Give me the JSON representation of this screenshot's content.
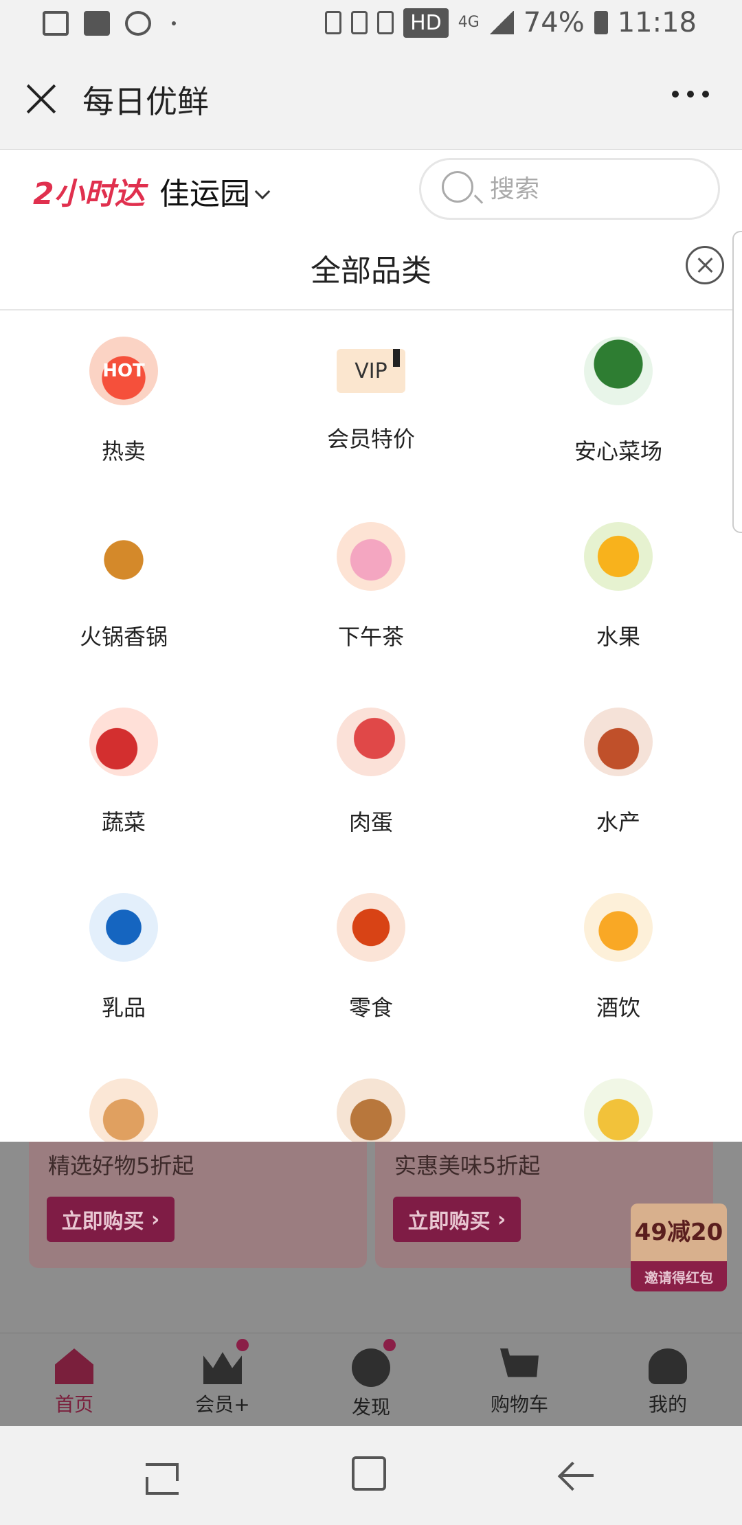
{
  "status_bar": {
    "network": "4G",
    "hd": "HD",
    "battery": "74%",
    "time": "11:18"
  },
  "title_bar": {
    "title": "每日优鲜"
  },
  "location_bar": {
    "brand": "2小时达",
    "location": "佳运园",
    "search_placeholder": "搜索"
  },
  "category_panel": {
    "title": "全部品类",
    "items": [
      {
        "label": "热卖",
        "icon": "hot-fire-icon",
        "badge": "HOT"
      },
      {
        "label": "会员特价",
        "icon": "vip-card-icon",
        "badge": "VIP"
      },
      {
        "label": "安心菜场",
        "icon": "bok-choy-icon"
      },
      {
        "label": "火锅香锅",
        "icon": "hotpot-icon"
      },
      {
        "label": "下午茶",
        "icon": "cake-drink-icon"
      },
      {
        "label": "水果",
        "icon": "citrus-icon"
      },
      {
        "label": "蔬菜",
        "icon": "tomato-icon"
      },
      {
        "label": "肉蛋",
        "icon": "meat-egg-icon"
      },
      {
        "label": "水产",
        "icon": "crab-fish-icon"
      },
      {
        "label": "乳品",
        "icon": "milk-icon"
      },
      {
        "label": "零食",
        "icon": "snack-bag-icon"
      },
      {
        "label": "酒饮",
        "icon": "beer-icon"
      },
      {
        "label": "",
        "icon": "roast-chicken-icon"
      },
      {
        "label": "",
        "icon": "bread-icon"
      },
      {
        "label": "",
        "icon": "corn-icon"
      }
    ]
  },
  "background_page": {
    "banners": [
      {
        "subtitle": "精选好物5折起",
        "button": "立即购买"
      },
      {
        "subtitle": "实惠美味5折起",
        "button": "立即购买"
      }
    ],
    "promo": {
      "big": "49减20",
      "small": "邀请得红包"
    },
    "tabs": [
      {
        "label": "首页",
        "active": true
      },
      {
        "label": "会员+",
        "dot": true
      },
      {
        "label": "发现",
        "dot": true
      },
      {
        "label": "购物车"
      },
      {
        "label": "我的"
      }
    ]
  },
  "colors": {
    "brand_red": "#e0304e",
    "tab_active": "#7a1f3c",
    "overlay_gray": "#8d8d8d"
  }
}
